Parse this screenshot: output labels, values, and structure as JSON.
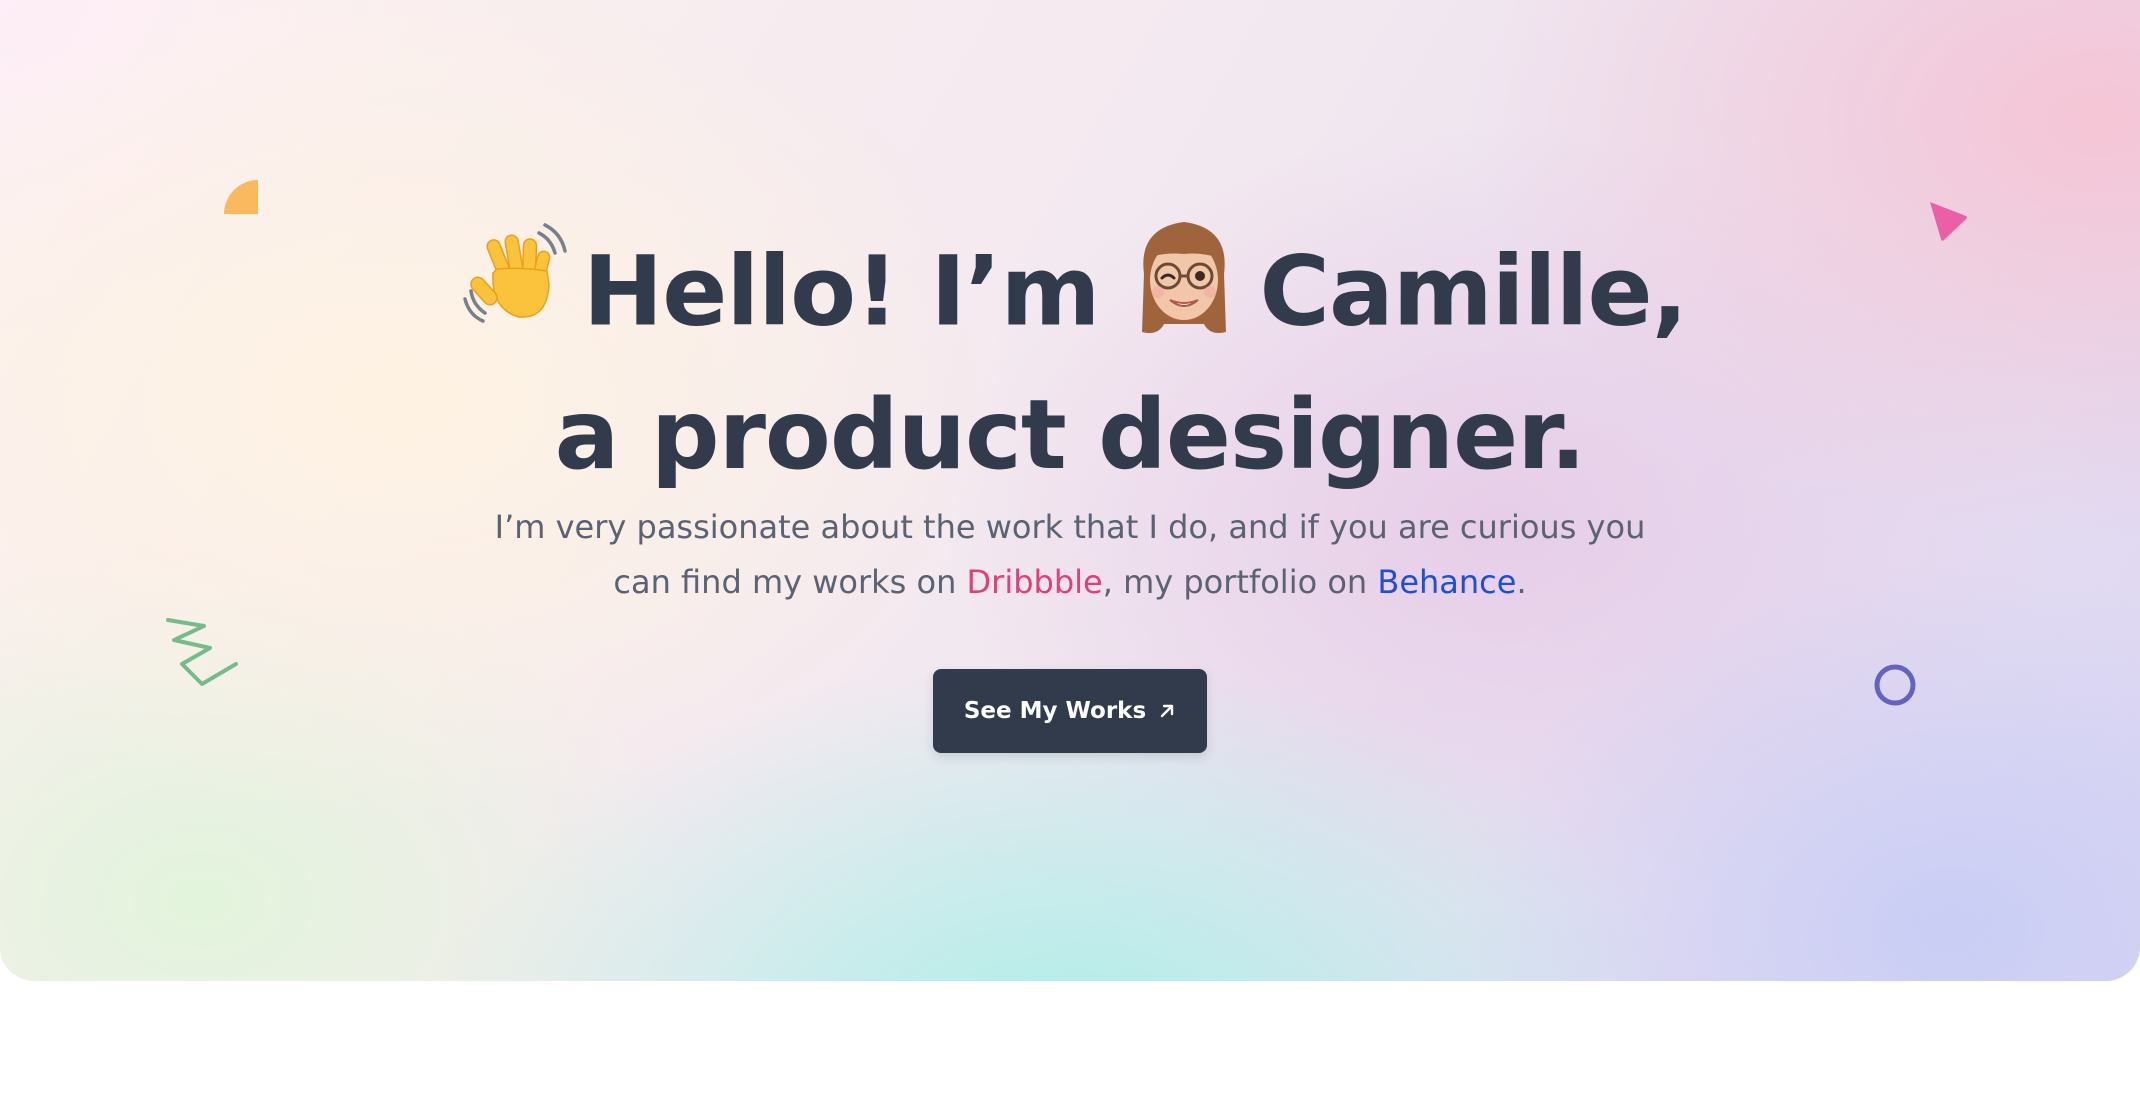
{
  "hero": {
    "greeting": "Hello! I’m",
    "name": "Camille,",
    "tagline": "a product designer.",
    "intro_part1": "I’m very passionate about the work that I do, and if you are curious you can find my works on ",
    "dribbble_label": "Dribbble",
    "intro_part2": ", my portfolio on ",
    "behance_label": "Behance",
    "intro_end": ".",
    "cta_label": "See My Works",
    "icons": {
      "wave": "waving-hand-icon",
      "avatar": "memoji-avatar-icon",
      "cta": "arrow-up-right-icon"
    }
  },
  "colors": {
    "text": "#323b4c",
    "body_text": "#5b6273",
    "dribbble": "#e0407a",
    "behance": "#1f4fd6",
    "button": "#323b4c",
    "shape_orange": "#fbb95f",
    "shape_pink": "#ea5fa6",
    "shape_green": "#76bb8a",
    "shape_purple": "#6463c0"
  }
}
